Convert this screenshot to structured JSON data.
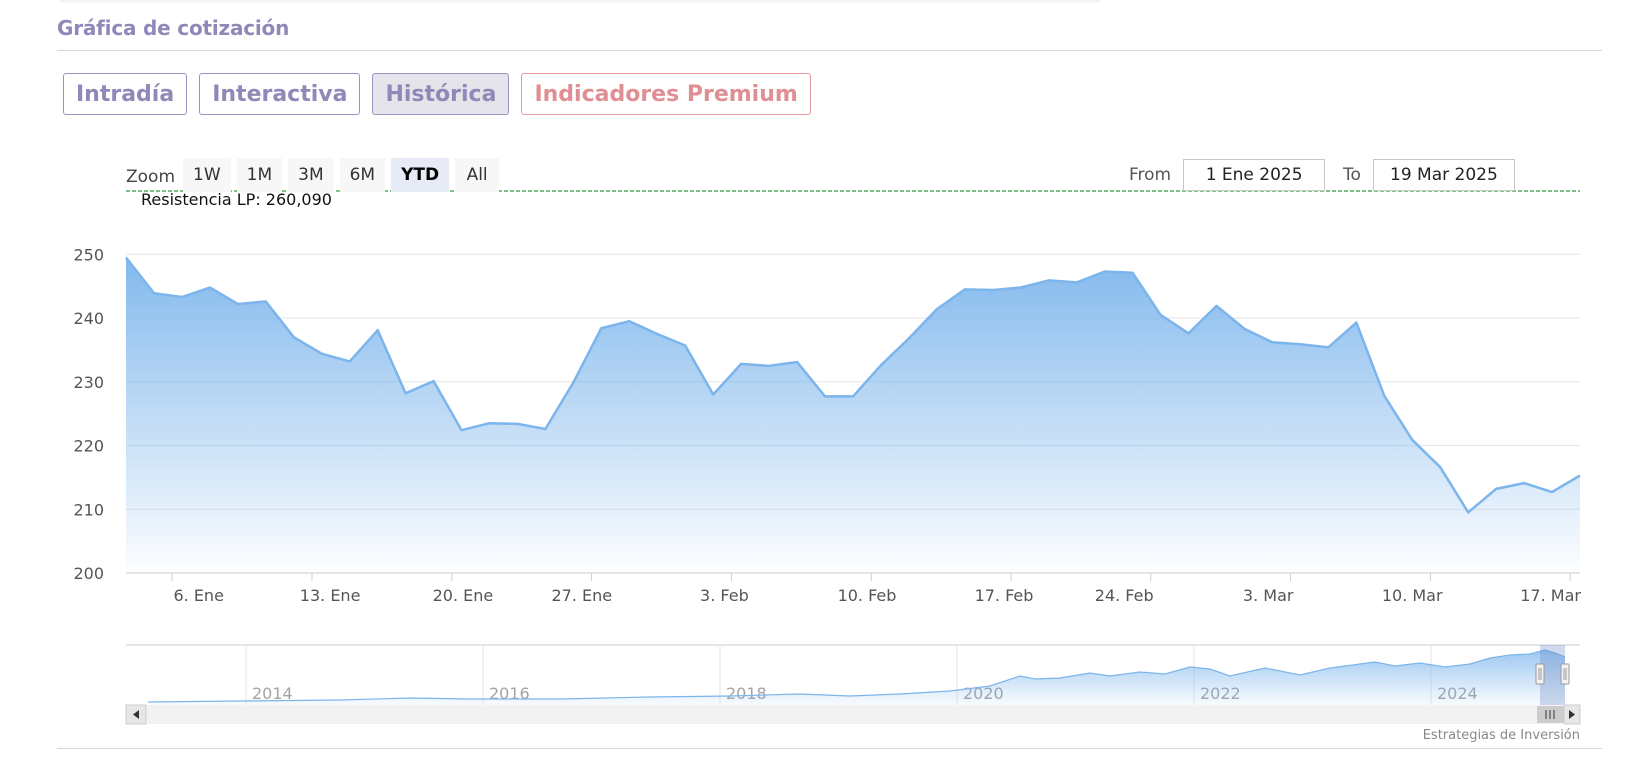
{
  "section": {
    "title": "Gráfica de cotización"
  },
  "tabs": [
    {
      "label": "Intradía",
      "active": false
    },
    {
      "label": "Interactiva",
      "active": false
    },
    {
      "label": "Histórica",
      "active": true
    },
    {
      "label": "Indicadores Premium",
      "active": false
    }
  ],
  "zoom": {
    "label": "Zoom",
    "buttons": [
      "1W",
      "1M",
      "3M",
      "6M",
      "YTD",
      "All"
    ],
    "selected": "YTD"
  },
  "range": {
    "from_label": "From",
    "from_value": "1 Ene 2025",
    "to_label": "To",
    "to_value": "19 Mar 2025"
  },
  "credits": "Estrategias de Inversión",
  "colors": {
    "accent": "#9088b8",
    "premium": "#df8f93",
    "series_line": "#7cb5ec",
    "resistance_line": "#2e9e3e"
  },
  "chart_data": {
    "type": "area",
    "title": "",
    "xlabel": "",
    "ylabel": "",
    "ylim": [
      200,
      260.09
    ],
    "yticks": [
      200,
      210,
      220,
      230,
      240,
      250
    ],
    "grid": true,
    "legend": "none",
    "x_start": "2 Ene 2025",
    "x_end": "19 Mar 2025",
    "x": [
      "2 Ene",
      "3 Ene",
      "6 Ene",
      "7 Ene",
      "8 Ene",
      "9 Ene",
      "10 Ene",
      "13 Ene",
      "14 Ene",
      "15 Ene",
      "16 Ene",
      "17 Ene",
      "20 Ene",
      "21 Ene",
      "22 Ene",
      "23 Ene",
      "24 Ene",
      "27 Ene",
      "28 Ene",
      "29 Ene",
      "30 Ene",
      "31 Ene",
      "3 Feb",
      "4 Feb",
      "5 Feb",
      "6 Feb",
      "7 Feb",
      "10 Feb",
      "11 Feb",
      "12 Feb",
      "13 Feb",
      "14 Feb",
      "17 Feb",
      "18 Feb",
      "19 Feb",
      "20 Feb",
      "21 Feb",
      "24 Feb",
      "25 Feb",
      "26 Feb",
      "27 Feb",
      "28 Feb",
      "3 Mar",
      "4 Mar",
      "5 Mar",
      "6 Mar",
      "7 Mar",
      "10 Mar",
      "11 Mar",
      "12 Mar",
      "13 Mar",
      "14 Mar",
      "17 Mar",
      "18 Mar",
      "19 Mar"
    ],
    "xtick_labels": [
      "6. Ene",
      "13. Ene",
      "20. Ene",
      "27. Ene",
      "3. Feb",
      "10. Feb",
      "17. Feb",
      "24. Feb",
      "3. Mar",
      "10. Mar",
      "17. Mar"
    ],
    "series": [
      {
        "values": [
          249.5,
          243.9,
          243.3,
          244.8,
          242.2,
          242.6,
          237.0,
          234.4,
          233.2,
          238.1,
          228.2,
          230.1,
          222.4,
          223.5,
          223.4,
          222.6,
          229.9,
          238.4,
          239.5,
          237.5,
          235.7,
          228.0,
          232.8,
          232.5,
          233.1,
          227.7,
          227.7,
          232.6,
          236.8,
          241.4,
          244.5,
          244.4,
          244.8,
          245.9,
          245.6,
          247.3,
          247.1,
          240.5,
          237.6,
          241.9,
          238.3,
          236.2,
          235.9,
          235.4,
          239.3,
          227.8,
          220.9,
          216.6,
          209.5,
          213.2,
          214.1,
          212.7,
          215.3
        ]
      }
    ],
    "reference_lines": [
      {
        "label": "Resistencia LP: 260,090",
        "value": 260.09,
        "style": "dashed"
      }
    ],
    "navigator": {
      "year_labels": [
        "2014",
        "2016",
        "2018",
        "2020",
        "2022",
        "2024"
      ]
    }
  }
}
